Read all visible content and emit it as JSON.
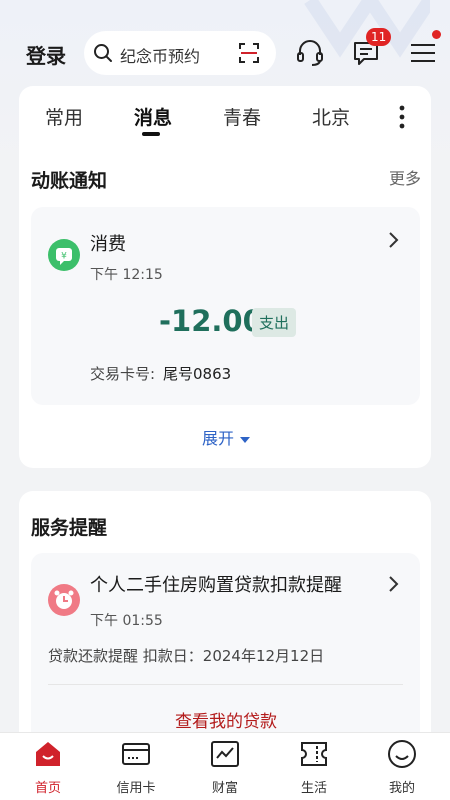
{
  "header": {
    "login_label": "登录",
    "search_placeholder": "纪念币预约",
    "message_badge": "11",
    "icons": [
      "search-icon",
      "scan-icon",
      "customer-service-icon",
      "message-icon",
      "menu-icon"
    ]
  },
  "tabs": [
    {
      "label": "常用"
    },
    {
      "label": "消息"
    },
    {
      "label": "青春"
    },
    {
      "label": "北京"
    }
  ],
  "active_tab": "消息",
  "account_notice": {
    "title": "动账通知",
    "more_label": "更多",
    "item": {
      "title": "消费",
      "time": "下午 12:15",
      "amount": "-12.00",
      "type_tag": "支出",
      "card_label": "交易卡号:",
      "card_value": "尾号0863"
    },
    "expand_label": "展开"
  },
  "service_reminder": {
    "title": "服务提醒",
    "item": {
      "title": "个人二手住房购置贷款扣款提醒",
      "time": "下午 01:55",
      "detail": "贷款还款提醒 扣款日：2024年12月12日"
    },
    "action_label": "查看我的贷款"
  },
  "bottom_nav": [
    {
      "label": "首页"
    },
    {
      "label": "信用卡"
    },
    {
      "label": "财富"
    },
    {
      "label": "生活"
    },
    {
      "label": "我的"
    }
  ],
  "colors": {
    "brand_red": "#d0222b",
    "amount_green": "#1f6f5c",
    "link_blue": "#2e63c6",
    "badge_red": "#e02424"
  }
}
